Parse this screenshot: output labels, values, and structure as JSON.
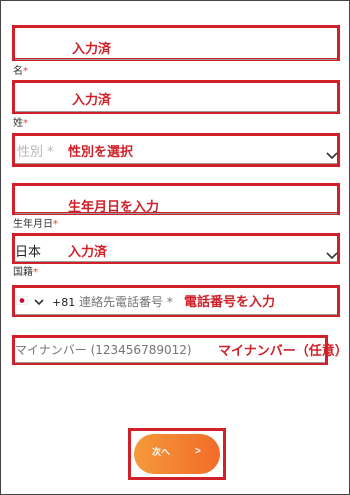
{
  "colors": {
    "annotation": "#d0202a",
    "required": "#e0412f",
    "button_start": "#f49a3a",
    "button_end": "#f26b2a"
  },
  "annotations": {
    "field1": "入力済",
    "field2": "入力済",
    "gender": "性別を選択",
    "birthdate": "生年月日を入力",
    "nationality": "入力済",
    "phone": "電話番号を入力",
    "mynumber": "マイナンバー（任意）"
  },
  "fields": {
    "first_name": {
      "label": "名",
      "required_mark": "*",
      "value": ""
    },
    "last_name": {
      "label": "姓",
      "required_mark": "*",
      "value": ""
    },
    "gender": {
      "placeholder": "性別 *",
      "icon": "chevron-down-icon"
    },
    "birthdate": {
      "label": "生年月日",
      "required_mark": "*",
      "value": ""
    },
    "nationality": {
      "label": "国籍",
      "required_mark": "*",
      "value": "日本",
      "icon": "chevron-down-icon"
    },
    "phone": {
      "flag_icon": "japan-flag-icon",
      "country_code": "+81",
      "placeholder": "連絡先電話番号 *"
    },
    "mynumber": {
      "placeholder": "マイナンバー (123456789012)"
    }
  },
  "next_button": {
    "label": "次へ",
    "arrow": ">"
  }
}
